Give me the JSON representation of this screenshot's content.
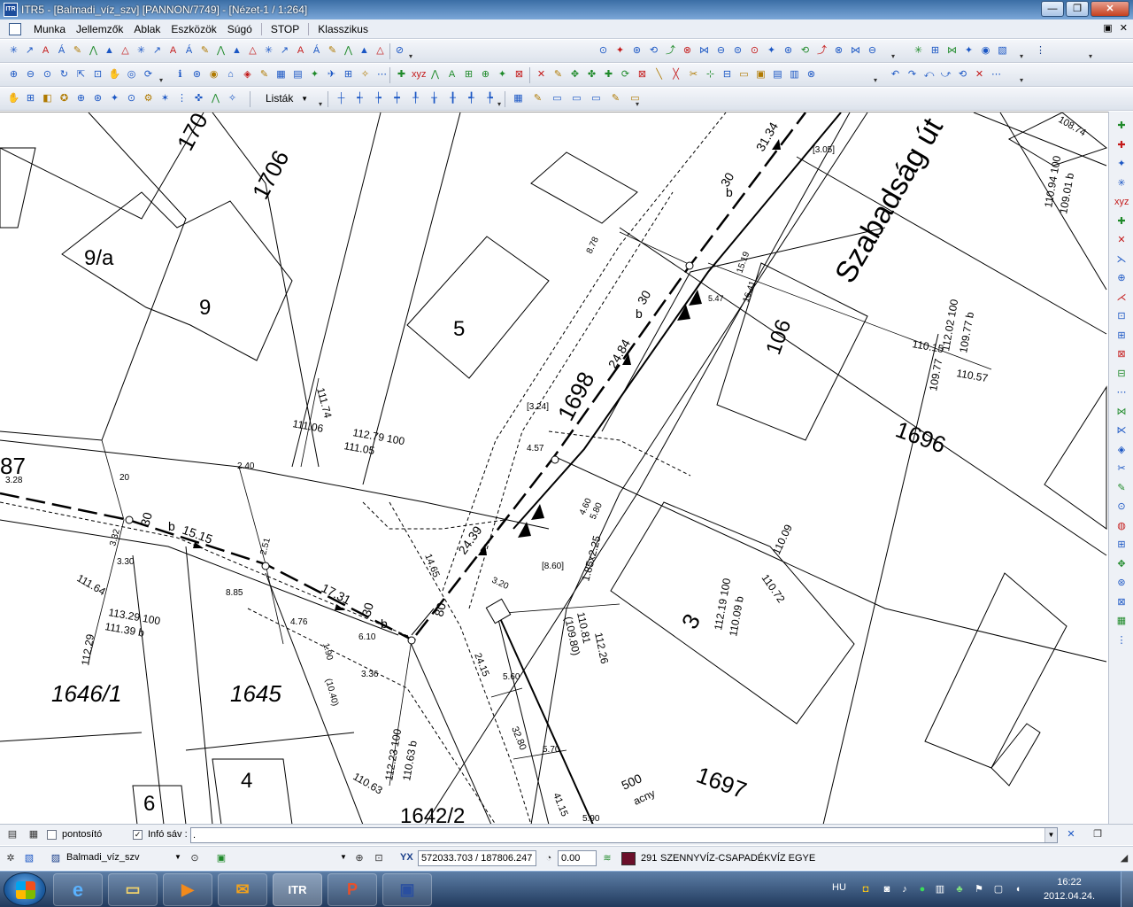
{
  "window": {
    "title": "ITR5 - [Balmadi_víz_szv] [PANNON/7749] - [Nézet-1 / 1:264]",
    "app_icon_text": "ITR",
    "minimize": "—",
    "maximize": "❐",
    "close": "✕"
  },
  "menu": {
    "items": [
      "Munka",
      "Jellemzők",
      "Ablak",
      "Eszközök",
      "Súgó",
      "STOP",
      "Klasszikus"
    ],
    "mdi_restore": "▣",
    "mdi_close": "✕"
  },
  "toolbar3": {
    "lists_label": "Listák"
  },
  "map": {
    "parcels": [
      "1706",
      "9/a",
      "9",
      "5",
      "1698",
      "106",
      "1696",
      "1646/1",
      "1645",
      "4",
      "6",
      "1642/2",
      "1697",
      "87",
      "170",
      "3"
    ],
    "street_name": "Szabadság út",
    "distance_labels": [
      "31.34",
      "24.84",
      "24.39",
      "17.31",
      "15.15",
      "32.80",
      "41.15",
      "24.15",
      "14.65"
    ],
    "pipe_labels": [
      "30",
      "b",
      "80"
    ],
    "level_labels": [
      "112.79 100",
      "111.05",
      "111.74",
      "111.64",
      "111.06",
      "110.94 100",
      "109.01 b",
      "112.02 100",
      "109.77 b",
      "110.15",
      "109.77",
      "110.57",
      "113.29 100",
      "111.39 b",
      "112.29",
      "112.23 100",
      "110.63 b",
      "110.63",
      "112.19 100",
      "110.09 b",
      "110.09",
      "110.72",
      "112.26",
      "110.81",
      "(109.80)",
      "1.85x2.25",
      "108.74"
    ],
    "small_labels": [
      "8.78",
      "15.19",
      "16.41",
      "[3.05]",
      "[3.24]",
      "4.57",
      "4.60",
      "5.80",
      "20",
      "2.40",
      "2.51",
      "8.85",
      "4.76",
      "1.90",
      "3.36",
      "3.30",
      "3.32",
      "3.20",
      "5.60",
      "5.70",
      "5.90",
      "6.10",
      "(10.40)",
      "[8.60]",
      "500",
      "acny",
      "5.47",
      "3.28"
    ]
  },
  "statusbar": {
    "pontosito_label": "pontosító",
    "pontosito_checked": false,
    "info_sav_label": "Infó sáv :",
    "info_sav_checked": true,
    "info_sav_value": ".",
    "project_name": "Balmadi_víz_szv",
    "coord_label": "YX",
    "coords": "572033.703 / 187806.247",
    "angle_value": "0.00",
    "layer_number": "291",
    "layer_name": "SZENNYVÍZ-CSAPADÉKVÍZ EGYE",
    "layer_color": "#6b0f2a"
  },
  "taskbar": {
    "apps": [
      "ie",
      "explorer",
      "media-player",
      "outlook",
      "ITR",
      "powerpoint",
      "save"
    ],
    "itr_label": "ITR",
    "language": "HU",
    "time": "16:22",
    "date": "2012.04.24."
  }
}
